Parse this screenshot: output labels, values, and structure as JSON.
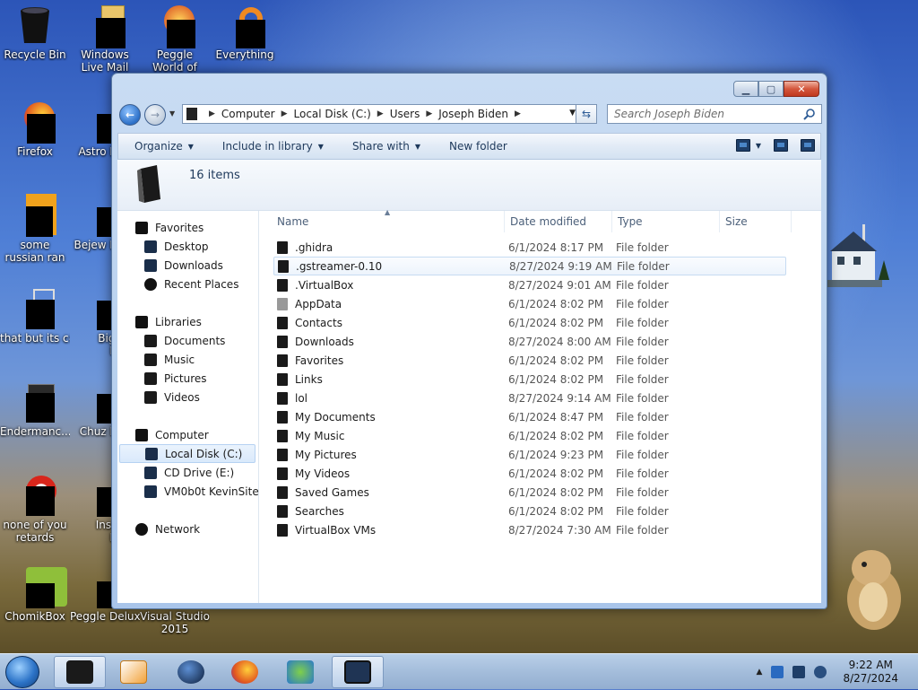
{
  "desktop": {
    "icons": [
      {
        "label": "Recycle Bin"
      },
      {
        "label": "Windows Live Mail"
      },
      {
        "label": "Peggle World of Warcraft"
      },
      {
        "label": "Everything"
      },
      {
        "label": "Firefox"
      },
      {
        "label": "Astro Delu"
      },
      {
        "label": "some russian ran a rat"
      },
      {
        "label": "Bejew Delu"
      },
      {
        "label": "that but its c#"
      },
      {
        "label": "Big Mo Delu"
      },
      {
        "label": "Endermanc..."
      },
      {
        "label": "Chuz Delu"
      },
      {
        "label": "none of you retards kno..."
      },
      {
        "label": "Insaniq Delu"
      },
      {
        "label": "ChomikBox"
      },
      {
        "label": "Peggle Deluxe"
      },
      {
        "label": "Visual Studio 2015"
      }
    ]
  },
  "explorer": {
    "breadcrumb": [
      "Computer",
      "Local Disk (C:)",
      "Users",
      "Joseph Biden"
    ],
    "search_placeholder": "Search Joseph Biden",
    "commands": {
      "organize": "Organize",
      "include": "Include in library",
      "share": "Share with",
      "new_folder": "New folder"
    },
    "item_count": "16 items",
    "nav": {
      "favorites": "Favorites",
      "desktop": "Desktop",
      "downloads": "Downloads",
      "recent": "Recent Places",
      "libraries": "Libraries",
      "documents": "Documents",
      "music": "Music",
      "pictures": "Pictures",
      "videos": "Videos",
      "computer": "Computer",
      "local_disk": "Local Disk (C:)",
      "cd_drive": "CD Drive (E:)",
      "vm": "VM0b0t KevinSite",
      "network": "Network"
    },
    "columns": {
      "name": "Name",
      "date": "Date modified",
      "type": "Type",
      "size": "Size"
    },
    "files": [
      {
        "name": ".ghidra",
        "date": "6/1/2024 8:17 PM",
        "type": "File folder"
      },
      {
        "name": ".gstreamer-0.10",
        "date": "8/27/2024 9:19 AM",
        "type": "File folder"
      },
      {
        "name": ".VirtualBox",
        "date": "8/27/2024 9:01 AM",
        "type": "File folder"
      },
      {
        "name": "AppData",
        "date": "6/1/2024 8:02 PM",
        "type": "File folder"
      },
      {
        "name": "Contacts",
        "date": "6/1/2024 8:02 PM",
        "type": "File folder"
      },
      {
        "name": "Downloads",
        "date": "8/27/2024 8:00 AM",
        "type": "File folder"
      },
      {
        "name": "Favorites",
        "date": "6/1/2024 8:02 PM",
        "type": "File folder"
      },
      {
        "name": "Links",
        "date": "6/1/2024 8:02 PM",
        "type": "File folder"
      },
      {
        "name": "lol",
        "date": "8/27/2024 9:14 AM",
        "type": "File folder"
      },
      {
        "name": "My Documents",
        "date": "6/1/2024 8:47 PM",
        "type": "File folder"
      },
      {
        "name": "My Music",
        "date": "6/1/2024 8:02 PM",
        "type": "File folder"
      },
      {
        "name": "My Pictures",
        "date": "6/1/2024 9:23 PM",
        "type": "File folder"
      },
      {
        "name": "My Videos",
        "date": "6/1/2024 8:02 PM",
        "type": "File folder"
      },
      {
        "name": "Saved Games",
        "date": "6/1/2024 8:02 PM",
        "type": "File folder"
      },
      {
        "name": "Searches",
        "date": "6/1/2024 8:02 PM",
        "type": "File folder"
      },
      {
        "name": "VirtualBox VMs",
        "date": "8/27/2024 7:30 AM",
        "type": "File folder"
      }
    ]
  },
  "taskbar": {
    "time": "9:22 AM",
    "date": "8/27/2024"
  }
}
